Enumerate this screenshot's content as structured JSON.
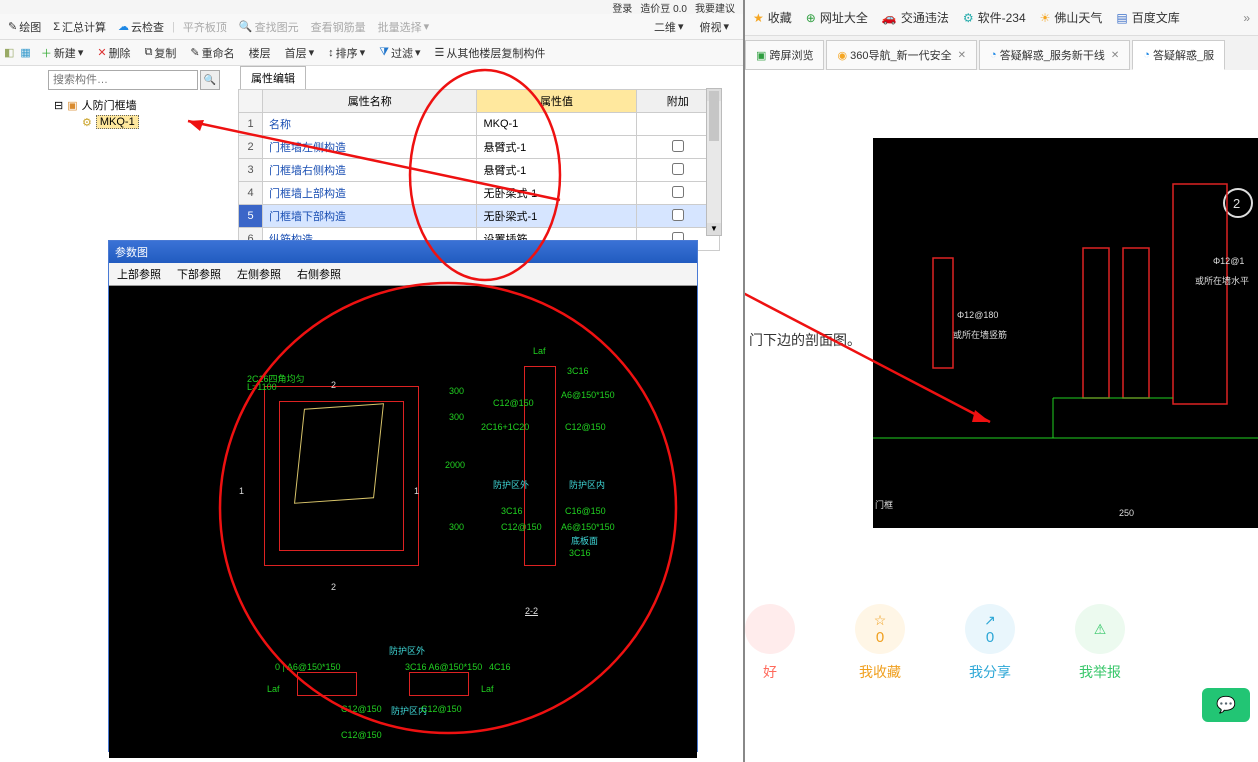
{
  "top": {
    "login": "登录",
    "price": "造价豆 0.0",
    "sugg": "我要建议"
  },
  "toolbar1": {
    "draw": "绘图",
    "sum": "汇总计算",
    "cloud": "云检查",
    "flat": "平齐板顶",
    "find": "查找图元",
    "rebar": "查看钢筋量",
    "batch": "批量选择",
    "view2d": "二维",
    "look": "俯视"
  },
  "toolbar2": {
    "new": "新建",
    "del": "删除",
    "copy": "复制",
    "rename": "重命名",
    "floor": "楼层",
    "first": "首层",
    "sort": "排序",
    "filter": "过滤",
    "copyfrom": "从其他楼层复制构件"
  },
  "search": {
    "placeholder": "搜索构件…"
  },
  "tree": {
    "root": "人防门框墙",
    "child": "MKQ-1"
  },
  "prop": {
    "tab": "属性编辑",
    "h_name": "属性名称",
    "h_val": "属性值",
    "h_add": "附加",
    "rows": [
      {
        "n": "1",
        "name": "名称",
        "val": "MKQ-1"
      },
      {
        "n": "2",
        "name": "门框墙左侧构造",
        "val": "悬臂式-1"
      },
      {
        "n": "3",
        "name": "门框墙右侧构造",
        "val": "悬臂式-1"
      },
      {
        "n": "4",
        "name": "门框墙上部构造",
        "val": "无卧梁式-1"
      },
      {
        "n": "5",
        "name": "门框墙下部构造",
        "val": "无卧梁式-1"
      },
      {
        "n": "6",
        "name": "纵筋构造",
        "val": "设置插筋"
      }
    ]
  },
  "param": {
    "title": "参数图",
    "tabs": [
      "上部参照",
      "下部参照",
      "左侧参照",
      "右侧参照"
    ],
    "labels": {
      "tl": "2C16四角均匀",
      "l1": "L=1100",
      "d1": "300",
      "d2": "300",
      "d3": "2000",
      "d4": "300",
      "sec": "2-2",
      "t1": "Laf",
      "t3": "3C16",
      "c12": "C12@150",
      "a6": "A6@150*150",
      "c216": "2C16+1C20",
      "zoneout": "防护区外",
      "zonein": "防护区内",
      "c16": "C16@150",
      "slab": "底板面",
      "sc16": "3C16",
      "btm_out": "防护区外",
      "btm_in": "防护区内",
      "b1": "0 | A6@150*150",
      "b2": "3C16  A6@150*150",
      "b3": "4C16",
      "bc": "C12@150"
    }
  },
  "browser": {
    "links": [
      "收藏",
      "网址大全",
      "交通违法",
      "软件-234",
      "佛山天气",
      "百度文库"
    ],
    "tabs": [
      {
        "t": "跨屏浏览"
      },
      {
        "t": "360导航_新一代安全"
      },
      {
        "t": "答疑解惑_服务新干线"
      },
      {
        "t": "答疑解惑_服"
      }
    ],
    "body_text": "门下边的剖面图。",
    "cad": {
      "a": "Φ12@180",
      "b": "或所在墙竖筋",
      "c": "Φ12@1",
      "d": "或所在墙水平",
      "e": "门框",
      "f": "250"
    },
    "actions": {
      "good": "好",
      "fav": {
        "label": "我收藏",
        "n": "0"
      },
      "share": {
        "label": "我分享",
        "n": "0"
      },
      "report": "我举报"
    }
  }
}
